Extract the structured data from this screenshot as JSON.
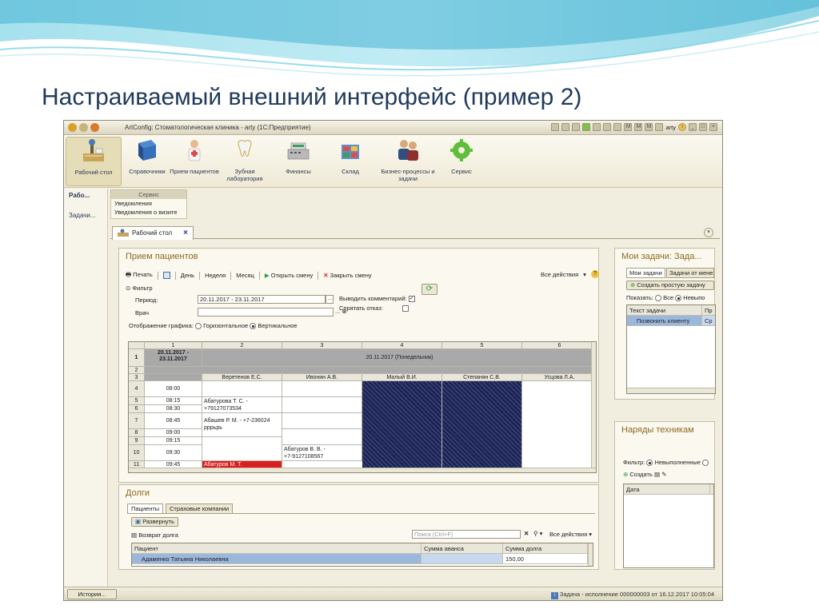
{
  "slide": {
    "title": "Настраиваемый внешний интерфейс (пример 2)"
  },
  "window": {
    "title": "ArtConfig: Стоматологическая клиника - arty  (1С:Предприятие)",
    "user": "arty"
  },
  "sections": [
    {
      "label": "Рабочий стол",
      "icon": "desktop-icon"
    },
    {
      "label": "Справочники",
      "icon": "book-icon"
    },
    {
      "label": "Прием пациентов",
      "icon": "doctor-icon"
    },
    {
      "label": "Зубная лаборатория",
      "icon": "tooth-icon"
    },
    {
      "label": "Финансы",
      "icon": "cash-register-icon"
    },
    {
      "label": "Склад",
      "icon": "warehouse-icon"
    },
    {
      "label": "Бизнес-процессы и задачи",
      "icon": "people-icon"
    },
    {
      "label": "Сервис",
      "icon": "gear-icon"
    }
  ],
  "left_nav": [
    "Рабо...",
    "Задачи..."
  ],
  "service_menu": {
    "title": "Сервис",
    "items": [
      "Уведомления",
      "Уведомления о визите"
    ]
  },
  "tab": {
    "label": "Рабочий стол"
  },
  "reception": {
    "title": "Прием пациентов",
    "toolbar": [
      "Печать",
      "День",
      "Неделя",
      "Месяц",
      "Открыть смену",
      "Закрыть смену"
    ],
    "all_actions": "Все действия",
    "filter_label": "Фильтр",
    "period_label": "Период:",
    "period_value": "20.11.2017 - 23.11.2017",
    "doctor_label": "Врач",
    "show_comment_label": "Выводить комментарий:",
    "hide_refusal_label": "Спрятать отказ:",
    "display_label": "Отображение графика:",
    "display_options": [
      "Горизонтальное",
      "Вертикальное"
    ],
    "grid": {
      "col_numbers": [
        "1",
        "2",
        "3",
        "4",
        "5",
        "6"
      ],
      "period_cell": "20.11.2017 - 23.11.2017",
      "day_header": "20.11.2017 (Понедельник)",
      "doctors": [
        "Веретенов Е.С.",
        "Ивонин А.В.",
        "Малый В.И.",
        "Степанян С.В.",
        "Усцова Л.А."
      ],
      "rows": [
        {
          "n": "1",
          "time": ""
        },
        {
          "n": "2",
          "time": ""
        },
        {
          "n": "3",
          "time": ""
        },
        {
          "n": "4",
          "time": "08:00"
        },
        {
          "n": "5",
          "time": "08:15"
        },
        {
          "n": "6",
          "time": "08:30"
        },
        {
          "n": "7",
          "time": "08:45"
        },
        {
          "n": "8",
          "time": "09:00"
        },
        {
          "n": "9",
          "time": "09:15"
        },
        {
          "n": "10",
          "time": "09:30"
        },
        {
          "n": "11",
          "time": "09:45"
        }
      ],
      "appointments": [
        {
          "text1": "Абатурова Т. С. -",
          "text2": "+79127073534"
        },
        {
          "text1": "Абашев Р. М. - +7-236024",
          "text2": "рррьрь"
        },
        {
          "text1": "Абатуров В. В. -",
          "text2": "+7-9127108567"
        },
        {
          "text1": "Абатуров М. Т."
        }
      ]
    }
  },
  "debts": {
    "title": "Долги",
    "tabs": [
      "Пациенты",
      "Страховые компании"
    ],
    "expand_btn": "Развернуть",
    "return_btn": "Возврат долга",
    "search_placeholder": "Поиск (Ctrl+F)",
    "all_actions": "Все действия",
    "columns": [
      "Пациент",
      "Сумма аванса",
      "Сумма долга"
    ],
    "rows": [
      {
        "patient": "Адаменко Татьяна Николаевна",
        "advance": "",
        "debt": "150,00"
      }
    ]
  },
  "my_tasks": {
    "title": "Мои задачи: Зада...",
    "tabs": [
      "Мои задачи",
      "Задачи от мене"
    ],
    "create_btn": "Создать простую задачу",
    "show_label": "Показать:",
    "show_options": [
      "Все",
      "Невыпо"
    ],
    "columns": [
      "Текст задачи",
      "Пр"
    ],
    "rows": [
      {
        "text": "Позвонить клиенту",
        "pr": "Ср"
      }
    ]
  },
  "orders": {
    "title": "Наряды техникам",
    "filter_label": "Фильтр:",
    "filter_option": "Невыполненные",
    "create_btn": "Создать",
    "columns": [
      "Дата"
    ]
  },
  "status": {
    "history_btn": "История...",
    "message": "Задача - исполнение 000000003 от 16.12.2017 10:05:04"
  }
}
